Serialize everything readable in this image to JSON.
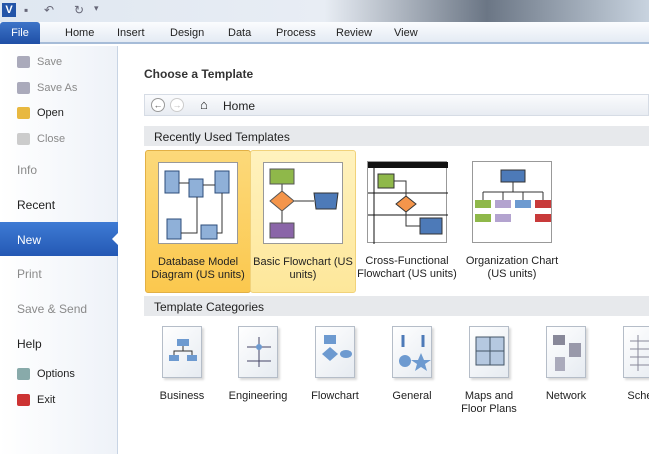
{
  "ribbon": {
    "file": "File",
    "tabs": [
      "Home",
      "Insert",
      "Design",
      "Data",
      "Process",
      "Review",
      "View"
    ]
  },
  "sidebar": {
    "save": "Save",
    "save_as": "Save As",
    "open": "Open",
    "close": "Close",
    "info": "Info",
    "recent": "Recent",
    "new": "New",
    "print": "Print",
    "save_send": "Save & Send",
    "help": "Help",
    "options": "Options",
    "exit": "Exit"
  },
  "main": {
    "title": "Choose a Template",
    "nav_home": "Home",
    "recent_header": "Recently Used Templates",
    "categories_header": "Template Categories",
    "recent": [
      {
        "label": "Database Model Diagram (US units)"
      },
      {
        "label": "Basic Flowchart (US units)"
      },
      {
        "label": "Cross-Functional Flowchart (US units)"
      },
      {
        "label": "Organization Chart (US units)"
      }
    ],
    "categories": [
      {
        "label": "Business"
      },
      {
        "label": "Engineering"
      },
      {
        "label": "Flowchart"
      },
      {
        "label": "General"
      },
      {
        "label": "Maps and Floor Plans"
      },
      {
        "label": "Network"
      },
      {
        "label": "Sched"
      }
    ]
  },
  "colors": {
    "accent": "#2458b4",
    "selected": "#fbc84e",
    "hover": "#fde79a"
  }
}
